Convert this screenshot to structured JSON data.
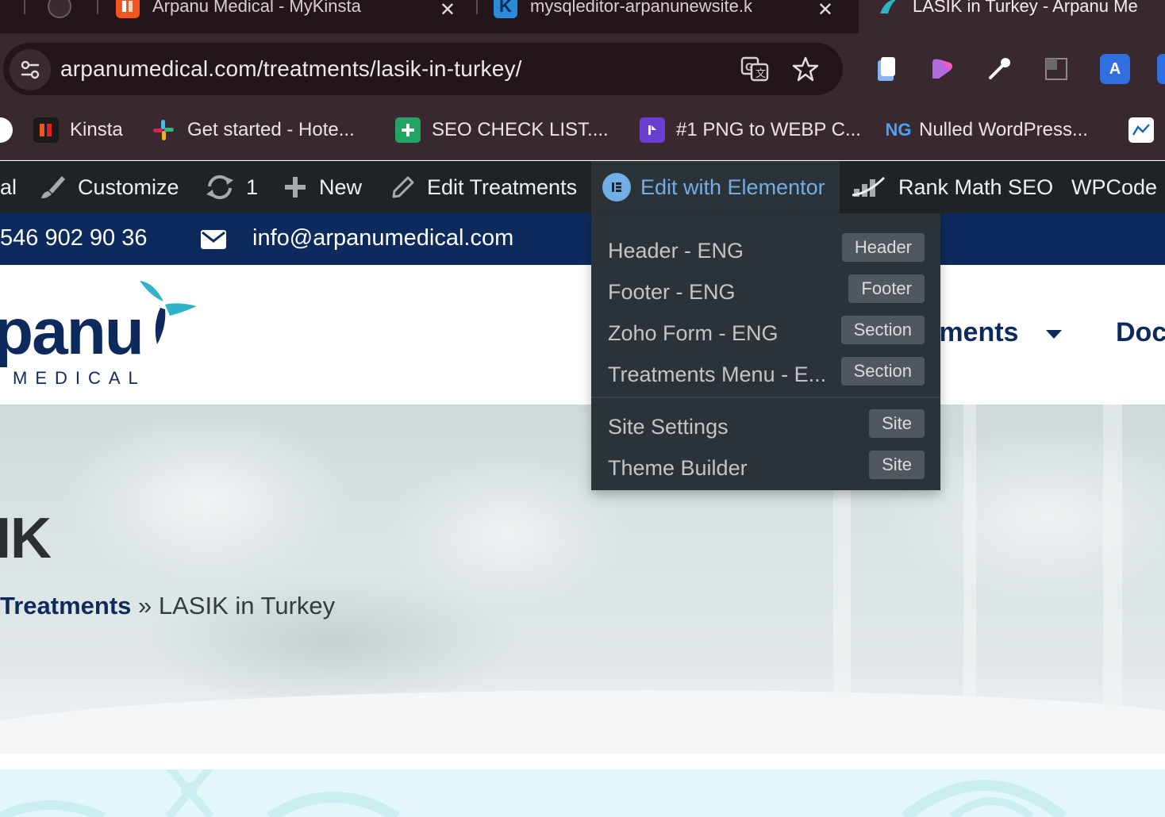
{
  "browser": {
    "tabs": [
      {
        "title": "Arpanu Medical - MyKinsta",
        "icon": "kinsta-icon"
      },
      {
        "title": "mysqleditor-arpanunewsite.k",
        "icon": "k-icon"
      },
      {
        "title": "LASIK in Turkey - Arpanu Me",
        "icon": "arpanu-icon",
        "active": true
      }
    ],
    "tab_close_glyph": "✕",
    "url": "arpanumedical.com/treatments/lasik-in-turkey/",
    "bookmarks": [
      {
        "label": "Kinsta",
        "icon": "kinsta-icon"
      },
      {
        "label": "Get started - Hote...",
        "icon": "slack-icon"
      },
      {
        "label": "SEO CHECK LIST....",
        "icon": "sheets-icon"
      },
      {
        "label": "#1 PNG to WEBP C...",
        "icon": "converter-icon"
      },
      {
        "label": "Nulled WordPress...",
        "icon": "ng-icon",
        "icon_text": "NG"
      }
    ]
  },
  "admin_bar": {
    "site_label": "al",
    "customize": "Customize",
    "updates_count": "1",
    "new": "New",
    "edit_treatments": "Edit Treatments",
    "edit_with_elementor": "Edit with Elementor",
    "rank_math": "Rank Math SEO",
    "wpcode": "WPCode"
  },
  "elementor_menu": {
    "templates": [
      {
        "label": "Header - ENG",
        "badge": "Header"
      },
      {
        "label": "Footer - ENG",
        "badge": "Footer"
      },
      {
        "label": "Zoho Form - ENG",
        "badge": "Section"
      },
      {
        "label": "Treatments Menu - E...",
        "badge": "Section"
      }
    ],
    "site": [
      {
        "label": "Site Settings",
        "badge": "Site"
      },
      {
        "label": "Theme Builder",
        "badge": "Site"
      }
    ]
  },
  "topbar": {
    "phone": "546 902 90 36",
    "email": "info@arpanumedical.com"
  },
  "header": {
    "logo_text": "panu",
    "logo_sub": "MEDICAL",
    "nav": [
      {
        "label": "tments"
      },
      {
        "label": "Doc"
      }
    ]
  },
  "hero": {
    "title": "IK",
    "breadcrumb_link": "Treatments",
    "breadcrumb_sep": " » ",
    "breadcrumb_current": "LASIK in Turkey"
  },
  "colors": {
    "navy": "#0d2a5c",
    "admin_bar": "#1d2327",
    "elementor_blue": "#72aee6",
    "browser_frame": "#3a2831",
    "logo_teal": "#2fb3c7",
    "bottom_band": "#e3f7fa"
  }
}
